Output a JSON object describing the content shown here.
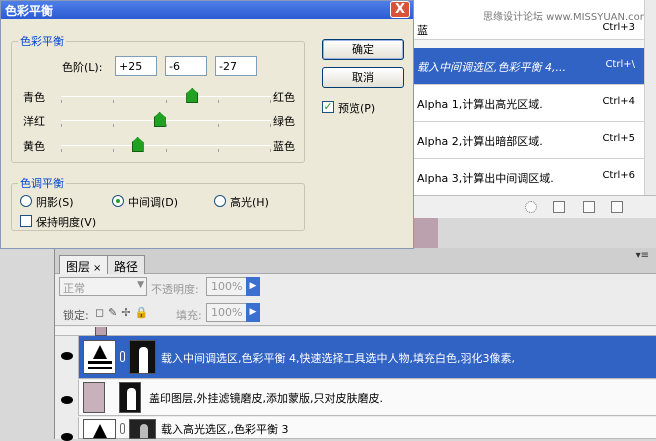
{
  "watermark": "思缘设计论坛 www.MISSYUAN.com",
  "channels_panel": {
    "rows": [
      {
        "name": "蓝",
        "shortcut": "Ctrl+3",
        "selected": false
      },
      {
        "name": "载入中间调选区,色彩平衡 4,...",
        "shortcut": "Ctrl+\\",
        "selected": true
      },
      {
        "name": "Alpha 1,计算出高光区域.",
        "shortcut": "Ctrl+4",
        "selected": false
      },
      {
        "name": "Alpha 2,计算出暗部区域.",
        "shortcut": "Ctrl+5",
        "selected": false
      },
      {
        "name": "Alpha 3,计算出中间调区域.",
        "shortcut": "Ctrl+6",
        "selected": false
      }
    ],
    "bottom_icons": [
      "dotted-circle-icon",
      "save-selection-icon",
      "new-channel-icon",
      "trash-icon"
    ]
  },
  "dialog": {
    "title": "色彩平衡",
    "close_label": "X",
    "color_balance_group": "色彩平衡",
    "levels_label": "色阶(L):",
    "levels": [
      "+25",
      "-6",
      "-27"
    ],
    "sliders": [
      {
        "left": "青色",
        "right": "红色",
        "value": 25
      },
      {
        "left": "洋红",
        "right": "绿色",
        "value": -6
      },
      {
        "left": "黄色",
        "right": "蓝色",
        "value": -27
      }
    ],
    "slider_range": [
      -100,
      100
    ],
    "tone_balance_group": "色调平衡",
    "tones": [
      {
        "label": "阴影(S)",
        "selected": false
      },
      {
        "label": "中间调(D)",
        "selected": true
      },
      {
        "label": "高光(H)",
        "selected": false
      }
    ],
    "preserve_luminosity": {
      "label": "保持明度(V)",
      "checked": false
    },
    "ok_label": "确定",
    "cancel_label": "取消",
    "preview": {
      "label": "预览(P)",
      "checked": true
    }
  },
  "layers_panel": {
    "tabs": [
      {
        "label": "图层",
        "close": "×"
      },
      {
        "label": "路径"
      }
    ],
    "menu_icon": "▾≡",
    "blend_mode": "正常",
    "opacity_label": "不透明度:",
    "opacity": "100%",
    "lock_label": "锁定:",
    "lock_icons": "◻✎✢🔒",
    "fill_label": "填充:",
    "fill": "100%",
    "layers": [
      {
        "name": "载入中间调选区,色彩平衡 4,快速选择工具选中人物,填充白色,羽化3像素,",
        "selected": true
      },
      {
        "name": "盖印图层,外挂滤镜磨皮,添加蒙版,只对皮肤磨皮.",
        "selected": false
      },
      {
        "name": "载入高光选区,,色彩平衡 3",
        "selected": false
      }
    ]
  },
  "colors": {
    "selection": "#3163c5",
    "title_bar": "#2b5bd2",
    "dialog_bg": "#ece9d8",
    "slider_thumb": "#21a121",
    "group_legend": "#0046d5"
  }
}
